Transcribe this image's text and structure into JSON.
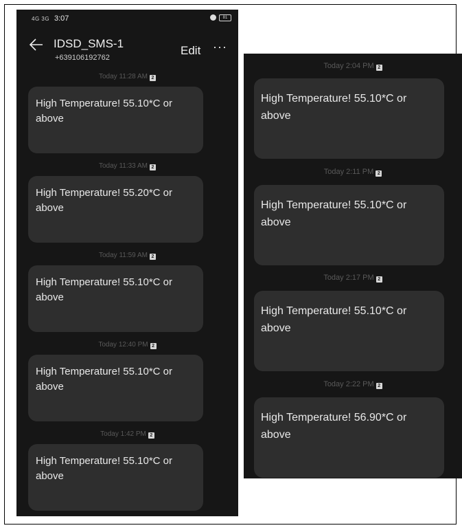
{
  "status_bar": {
    "signal": "4G 3G",
    "time": "3:07",
    "battery": "81"
  },
  "header": {
    "contact_name": "IDSD_SMS-1",
    "contact_number": "+639106192762",
    "edit_label": "Edit",
    "more_label": "···"
  },
  "sim_badge": "2",
  "left_messages": [
    {
      "timestamp": "Today 11:28 AM",
      "text": "High Temperature! 55.10*C or above"
    },
    {
      "timestamp": "Today 11:33 AM",
      "text": "High Temperature! 55.20*C or above"
    },
    {
      "timestamp": "Today 11:59 AM",
      "text": "High Temperature! 55.10*C or above"
    },
    {
      "timestamp": "Today 12:40 PM",
      "text": "High Temperature! 55.10*C or above"
    },
    {
      "timestamp": "Today 1:42 PM",
      "text": "High Temperature! 55.10*C or above"
    }
  ],
  "right_messages": [
    {
      "timestamp": "Today 2:04 PM",
      "text": "High Temperature! 55.10*C or above"
    },
    {
      "timestamp": "Today 2:11 PM",
      "text": "High Temperature! 55.10*C or above"
    },
    {
      "timestamp": "Today 2:17 PM",
      "text": "High Temperature! 55.10*C or above"
    },
    {
      "timestamp": "Today 2:22 PM",
      "text": "High Temperature! 56.90*C or above"
    }
  ],
  "colors": {
    "background": "#161616",
    "bubble": "#2e2e2e",
    "text": "#e8e8e8",
    "timestamp": "#595959"
  }
}
